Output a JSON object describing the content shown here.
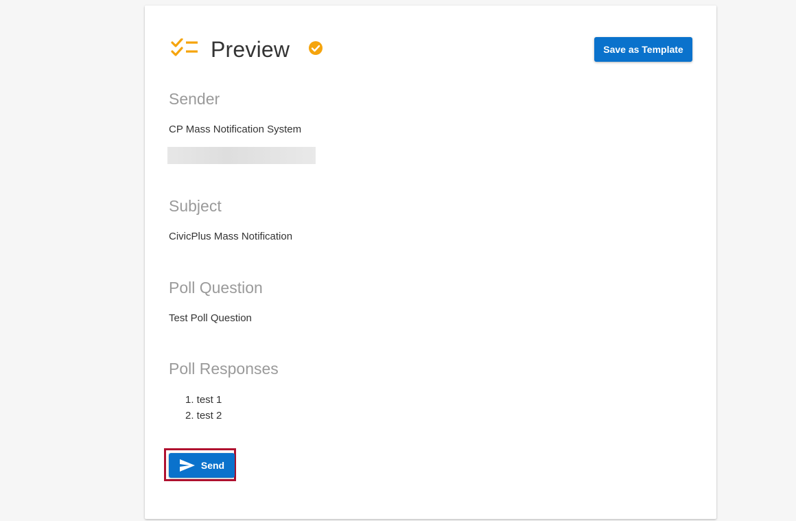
{
  "header": {
    "title": "Preview",
    "title_icon": "checklist-icon",
    "status_icon": "check-circle-icon",
    "accent_color": "#f5a40d",
    "save_template_label": "Save as Template"
  },
  "sections": {
    "sender": {
      "heading": "Sender",
      "value": "CP Mass Notification System"
    },
    "subject": {
      "heading": "Subject",
      "value": "CivicPlus Mass Notification"
    },
    "poll_question": {
      "heading": "Poll Question",
      "value": "Test Poll Question"
    },
    "poll_responses": {
      "heading": "Poll Responses",
      "items": [
        "1. test 1",
        "2. test 2"
      ]
    }
  },
  "actions": {
    "send_label": "Send",
    "send_icon": "send-icon",
    "button_color": "#0a72cc",
    "highlight_color": "#b0112f"
  }
}
